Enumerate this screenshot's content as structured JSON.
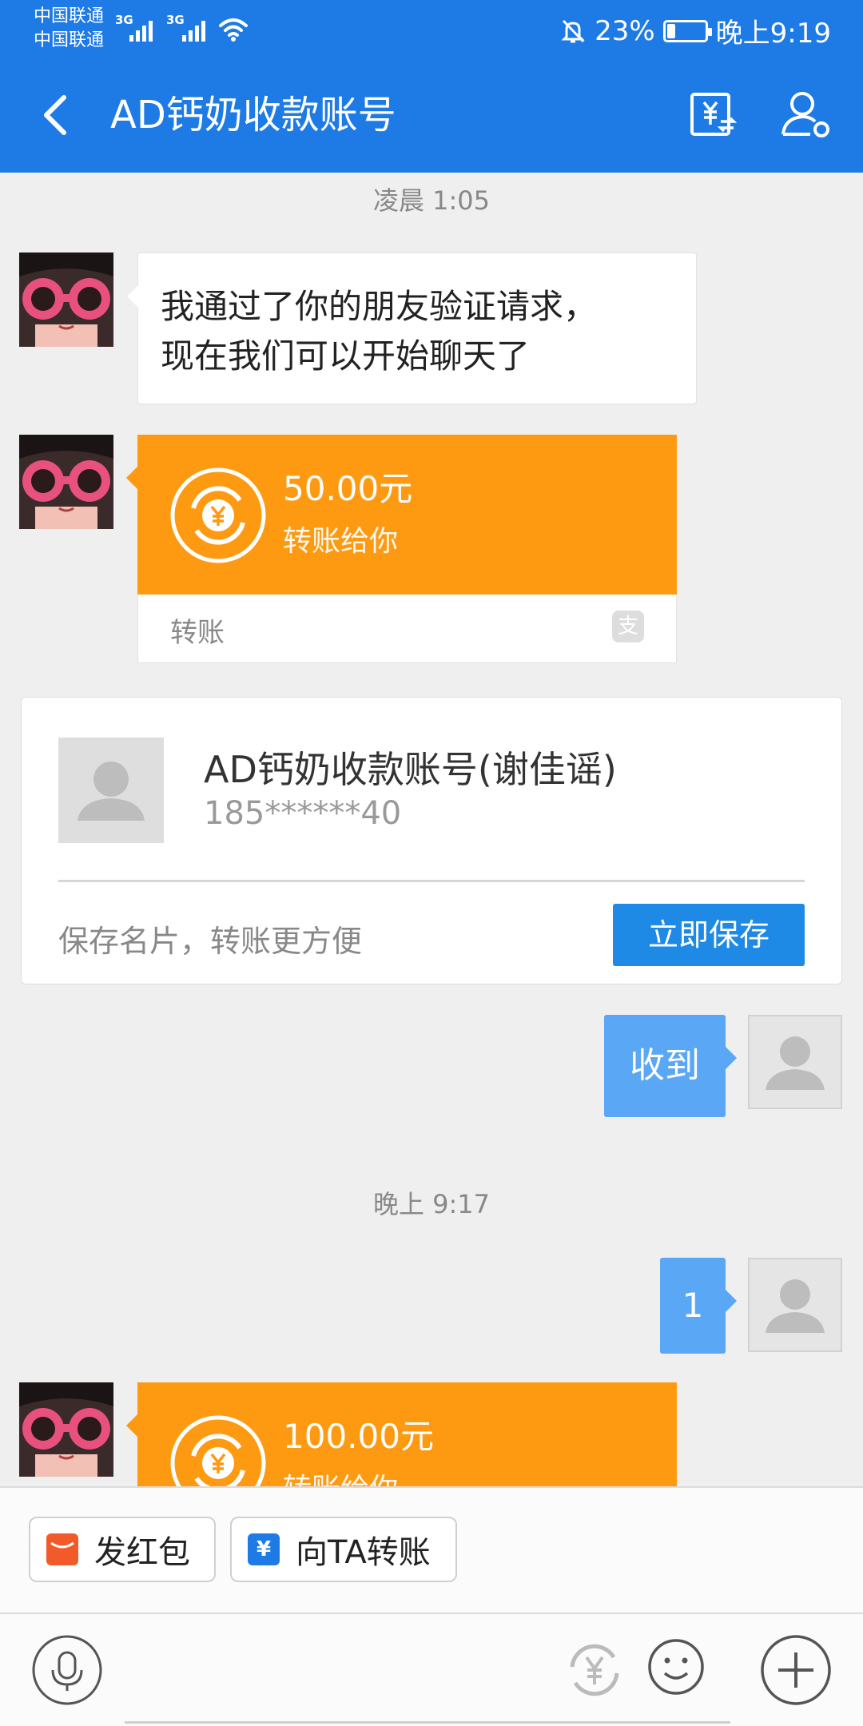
{
  "status_bar": {
    "carrier1": "中国联通",
    "carrier2": "中国联通",
    "network1": "3G",
    "network2": "3G",
    "battery_percent": "23%",
    "battery_level": 0.23,
    "time": "晚上9:19"
  },
  "header": {
    "title": "AD钙奶收款账号",
    "icons": [
      "back-icon",
      "yuan-transfer-icon",
      "person-settings-icon"
    ]
  },
  "messages": {
    "time1": "凌晨 1:05",
    "text1_line1": "我通过了你的朋友验证请求，",
    "text1_line2": "现在我们可以开始聊天了",
    "transfer1": {
      "amount": "50.00元",
      "subtitle": "转账给你",
      "footer": "转账",
      "alipay_glyph": "支"
    },
    "card": {
      "name": "AD钙奶收款账号(谢佳谣)",
      "phone": "185******40",
      "hint": "保存名片，转账更方便",
      "save_button": "立即保存"
    },
    "sent1": "收到",
    "time2": "晚上 9:17",
    "sent2": "1",
    "transfer2": {
      "amount": "100.00元",
      "subtitle": "转账给你"
    }
  },
  "bottom": {
    "red_packet": "发红包",
    "transfer_to": "向TA转账",
    "yuan_glyph": "¥",
    "icons": [
      "microphone-icon",
      "yuan-icon",
      "emoji-icon",
      "plus-icon"
    ]
  },
  "colors": {
    "header_blue": "#1e7be6",
    "transfer_orange": "#fe9a12",
    "sent_bubble_blue": "#5aa7f5",
    "save_button_blue": "#1e8ae6"
  }
}
